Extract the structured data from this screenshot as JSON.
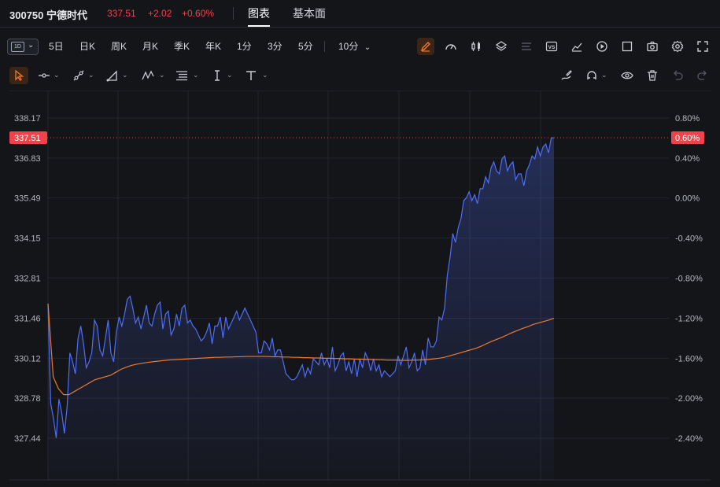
{
  "header": {
    "code": "300750 宁德时代",
    "price": "337.51",
    "change": "+2.02",
    "change_pct": "+0.60%",
    "tabs": [
      {
        "label": "图表",
        "active": true
      },
      {
        "label": "基本面",
        "active": false
      }
    ]
  },
  "toolbar": {
    "period_badge": "1D",
    "periods": [
      "5日",
      "日K",
      "周K",
      "月K",
      "季K",
      "年K",
      "1分",
      "3分",
      "5分"
    ],
    "interval_select": "10分",
    "right_icons": [
      "pen-icon",
      "gauge-icon",
      "candlestick-icon",
      "layers-icon",
      "menu-lines-icon",
      "vs-icon",
      "chart-area-icon",
      "replay-icon",
      "fullscreen-box-icon",
      "camera-icon",
      "settings-icon",
      "expand-icon"
    ],
    "vs_label": "VS"
  },
  "drawing_toolbar": {
    "left_tools": [
      "cursor-icon",
      "line-tool-icon",
      "ray-tool-icon",
      "triangle-tool-icon",
      "wave-tool-icon",
      "fib-tool-icon",
      "text-cursor-icon",
      "text-tool-icon"
    ],
    "right_tools": [
      "brush-icon",
      "magnet-icon",
      "eye-icon",
      "trash-icon",
      "undo-icon",
      "redo-icon"
    ]
  },
  "colors": {
    "background": "#141519",
    "price_line": "#4f6ef7",
    "avg_line": "#ee7a2e",
    "up": "#f2414b",
    "grid": "#23252c"
  },
  "chart_data": {
    "type": "line",
    "y_axis_left_ticks": [
      "338.17",
      "336.83",
      "335.49",
      "334.15",
      "332.81",
      "331.46",
      "330.12",
      "328.78",
      "327.44"
    ],
    "y_axis_right_ticks": [
      "0.80%",
      "0.40%",
      "0.00%",
      "-0.40%",
      "-0.80%",
      "-1.20%",
      "-1.60%",
      "-2.00%",
      "-2.40%"
    ],
    "ylim": [
      327.44,
      338.17
    ],
    "current_price_label": "337.51",
    "current_pct_label": "0.60%",
    "prev_close": 335.49,
    "x_total_slots": 72,
    "series": [
      {
        "values": [
          331.95,
          328.6,
          328.1,
          327.45,
          328.75,
          328.3,
          327.6,
          328.5,
          330.3,
          330.0,
          329.6,
          330.8,
          331.2,
          330.6,
          329.8,
          330.0,
          330.3,
          331.4,
          331.2,
          330.4,
          330.2,
          330.8,
          331.4,
          330.3,
          330.0,
          331.0,
          331.5,
          331.2,
          331.6,
          332.1,
          332.2,
          331.8,
          331.3,
          331.5,
          331.1,
          331.5,
          331.9,
          331.3,
          331.2,
          331.6,
          331.9,
          332.0,
          331.1,
          331.6,
          331.7,
          330.9,
          331.1,
          331.6,
          331.2,
          331.8,
          331.9,
          331.3,
          331.4,
          331.2,
          331.1,
          330.9,
          330.7,
          330.8,
          331.0,
          331.3,
          330.6,
          331.2,
          331.2,
          331.5,
          330.8,
          331.5,
          331.1,
          331.3,
          331.5,
          331.7,
          331.4,
          331.6,
          331.8,
          331.6,
          331.4,
          331.2,
          331.0,
          330.3,
          330.3,
          330.7,
          330.6,
          330.4,
          330.8,
          330.2,
          330.4,
          330.4,
          330.0,
          329.6,
          329.5,
          329.4,
          329.4,
          329.5,
          329.7,
          329.9,
          329.5,
          329.8,
          329.6,
          330.1,
          330.0,
          329.9,
          330.3,
          329.9,
          330.1,
          329.8,
          330.5,
          329.7,
          329.9,
          330.2,
          330.3,
          329.7,
          330.0,
          329.6,
          330.1,
          329.5,
          330.1,
          329.8,
          330.3,
          330.1,
          329.7,
          330.1,
          329.7,
          329.9,
          329.5,
          329.7,
          329.6,
          329.5,
          329.6,
          329.7,
          330.2,
          329.9,
          330.2,
          330.5,
          329.8,
          330.0,
          330.3,
          329.7,
          329.8,
          330.4,
          329.9,
          330.8,
          330.5,
          330.5,
          330.7,
          331.5,
          331.4,
          331.8,
          332.9,
          333.5,
          334.3,
          334.0,
          334.5,
          334.8,
          335.4,
          335.5,
          335.7,
          335.4,
          335.6,
          335.3,
          335.8,
          335.8,
          336.2,
          336.0,
          336.5,
          336.7,
          336.4,
          336.3,
          336.8,
          336.9,
          336.4,
          336.6,
          336.7,
          336.1,
          336.3,
          336.3,
          335.9,
          336.4,
          336.6,
          336.9,
          336.8,
          337.2,
          336.9,
          337.2,
          337.3,
          337.0,
          337.5,
          337.51
        ],
        "name": ""
      },
      {
        "values": [
          331.95,
          329.5,
          329.1,
          328.9,
          328.9,
          329.0,
          329.1,
          329.2,
          329.3,
          329.4,
          329.45,
          329.5,
          329.55,
          329.65,
          329.75,
          329.82,
          329.88,
          329.92,
          329.95,
          329.98,
          330.0,
          330.02,
          330.04,
          330.06,
          330.07,
          330.08,
          330.09,
          330.1,
          330.11,
          330.12,
          330.13,
          330.14,
          330.15,
          330.15,
          330.16,
          330.16,
          330.17,
          330.17,
          330.18,
          330.18,
          330.18,
          330.18,
          330.18,
          330.17,
          330.17,
          330.16,
          330.16,
          330.15,
          330.15,
          330.14,
          330.14,
          330.13,
          330.13,
          330.12,
          330.12,
          330.11,
          330.11,
          330.1,
          330.1,
          330.09,
          330.09,
          330.08,
          330.08,
          330.07,
          330.07,
          330.06,
          330.06,
          330.06,
          330.05,
          330.05,
          330.06,
          330.06,
          330.07,
          330.08,
          330.1,
          330.12,
          330.15,
          330.2,
          330.25,
          330.3,
          330.35,
          330.4,
          330.45,
          330.52,
          330.6,
          330.68,
          330.75,
          330.82,
          330.9,
          330.98,
          331.05,
          331.12,
          331.18,
          331.25,
          331.3,
          331.35,
          331.4,
          331.46
        ],
        "name": ""
      }
    ]
  }
}
